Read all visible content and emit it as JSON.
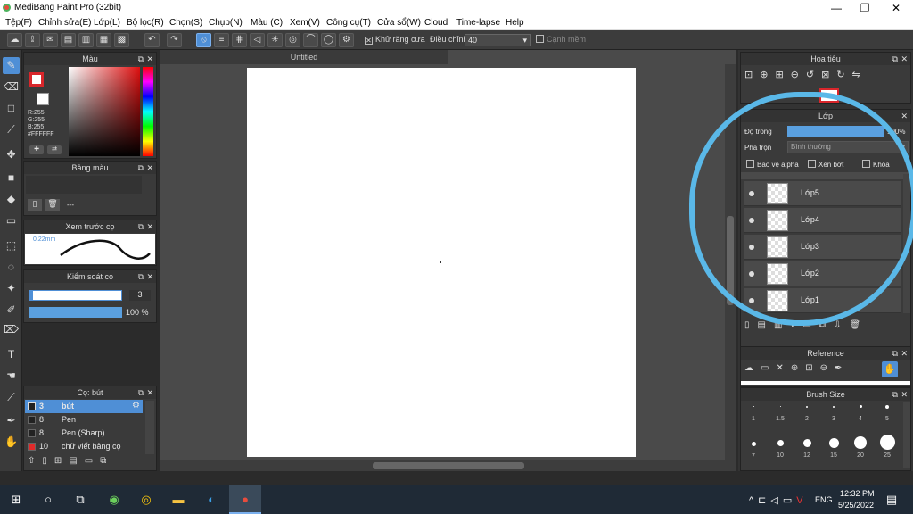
{
  "window": {
    "title": "MediBang Paint Pro (32bit)",
    "minimize": "—",
    "maximize": "❐",
    "close": "✕"
  },
  "menu": [
    "Tệp(F)",
    "Chỉnh sửa(E)",
    "Lớp(L)",
    "Bộ lọc(R)",
    "Chọn(S)",
    "Chụp(N)",
    "Màu (C)",
    "Xem(V)",
    "Công cụ(T)",
    "Cửa sổ(W)",
    "Cloud",
    "Time-lapse",
    "Help"
  ],
  "toolbar": {
    "antialias_label": "Khử răng cưa",
    "correction_label": "Điều chỉnh",
    "correction_value": "40",
    "edge_label": "Cạnh mềm"
  },
  "color_panel": {
    "title": "Màu",
    "r": "R:255",
    "g": "G:255",
    "b": "B:255",
    "hex": "#FFFFFF"
  },
  "palette_panel": {
    "title": "Bảng màu",
    "placeholder": "---"
  },
  "brush_preview": {
    "title": "Xem trước cọ",
    "size": "0.22mm"
  },
  "brush_control": {
    "title": "Kiểm soát cọ",
    "size_value": "3",
    "opacity_value": "100 %"
  },
  "brush_list": {
    "title": "Cọ: bút",
    "items": [
      {
        "size": "3",
        "name": "bút"
      },
      {
        "size": "8",
        "name": "Pen"
      },
      {
        "size": "8",
        "name": "Pen (Sharp)"
      },
      {
        "size": "10",
        "name": "chữ viết bảng cọ"
      }
    ]
  },
  "canvas": {
    "tab": "Untitled"
  },
  "navigator": {
    "title": "Hoa tiêu"
  },
  "layer_panel": {
    "title": "Lớp",
    "opacity_label": "Độ trong",
    "opacity_value": "100%",
    "blend_label": "Pha trộn",
    "blend_value": "Bình thường",
    "protect_alpha": "Bảo vệ alpha",
    "clipping": "Xén bớt",
    "lock": "Khóa",
    "layers": [
      "Lớp5",
      "Lớp4",
      "Lớp3",
      "Lớp2",
      "Lớp1"
    ]
  },
  "reference": {
    "title": "Reference"
  },
  "brush_size": {
    "title": "Brush Size",
    "row1": [
      "1",
      "1.5",
      "2",
      "3",
      "4",
      "5"
    ],
    "row2": [
      "7",
      "10",
      "12",
      "15",
      "20",
      "25"
    ]
  },
  "taskbar": {
    "lang": "ENG",
    "time": "12:32 PM",
    "date": "5/25/2022"
  },
  "colors": {
    "accent": "#4f8fd6",
    "annotation": "#5ab8e8",
    "primary": "#d9262b"
  }
}
